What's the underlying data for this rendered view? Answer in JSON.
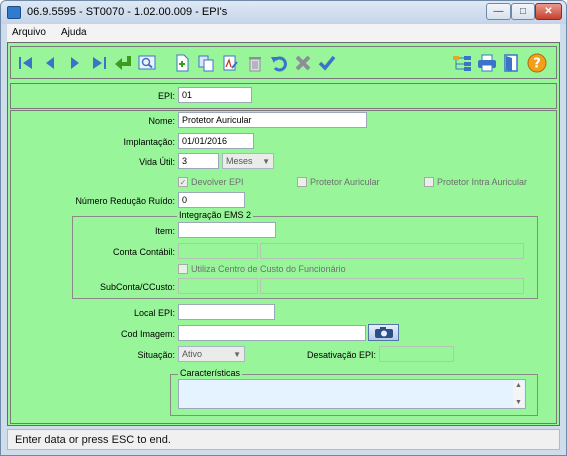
{
  "window": {
    "title": "06.9.5595 - ST0070 - 1.02.00.009 - EPI's",
    "minimize_glyph": "—",
    "maximize_glyph": "□",
    "close_glyph": "✕"
  },
  "menubar": {
    "items": [
      "Arquivo",
      "Ajuda"
    ]
  },
  "toolbar": {
    "icons": [
      "first-record-icon",
      "previous-record-icon",
      "next-record-icon",
      "last-record-icon",
      "return-icon",
      "search-icon",
      "new-record-icon",
      "copy-record-icon",
      "edit-record-icon",
      "delete-icon",
      "undo-icon",
      "cancel-icon",
      "confirm-icon",
      "tree-icon",
      "print-icon",
      "exit-door-icon",
      "help-icon"
    ]
  },
  "form": {
    "epi_label": "EPI:",
    "epi_value": "01",
    "nome_label": "Nome:",
    "nome_value": "Protetor Auricular",
    "implantacao_label": "Implantação:",
    "implantacao_value": "01/01/2016",
    "vida_util_label": "Vida Útil:",
    "vida_util_value": "3",
    "vida_util_unit": "Meses",
    "devolver_epi_label": "Devolver EPI",
    "devolver_epi_checked": true,
    "protetor_auricular_label": "Protetor Auricular",
    "protetor_auricular_checked": false,
    "protetor_intra_label": "Protetor Intra Auricular",
    "protetor_intra_checked": false,
    "reducao_ruido_label": "Número Redução Ruído:",
    "reducao_ruido_value": "0",
    "integracao_title": "Integração EMS 2",
    "item_label": "Item:",
    "item_value": "",
    "conta_contabil_label": "Conta Contábil:",
    "conta_contabil_value": "",
    "conta_contabil_desc": "",
    "utiliza_ccusto_label": "Utiliza Centro de Custo do Funcionário",
    "utiliza_ccusto_checked": false,
    "subconta_label": "SubConta/CCusto:",
    "subconta_value": "",
    "subconta_desc": "",
    "local_epi_label": "Local EPI:",
    "local_epi_value": "",
    "cod_imagem_label": "Cod Imagem:",
    "cod_imagem_value": "",
    "situacao_label": "Situação:",
    "situacao_value": "Ativo",
    "desativacao_label": "Desativação EPI:",
    "desativacao_value": "",
    "caracteristicas_title": "Características",
    "caracteristicas_value": ""
  },
  "status": {
    "text": "Enter data or press ESC to end."
  },
  "colors": {
    "form_background": "#99f59a",
    "toolbar_icon_blue": "#3b73c9",
    "toolbar_icon_green": "#3e9a21"
  }
}
